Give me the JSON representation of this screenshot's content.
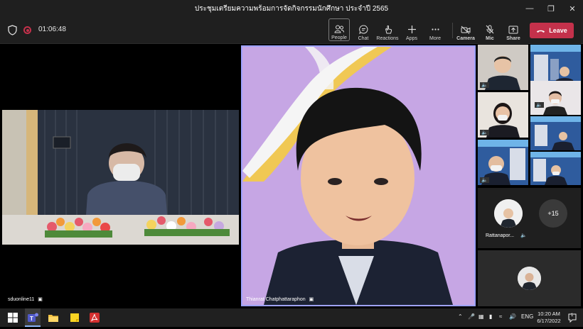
{
  "window": {
    "title": "ประชุมเตรียมความพร้อมการจัดกิจกรรมนักศึกษา ประจำปี 2565"
  },
  "toolbar": {
    "timer": "01:06:48",
    "people_label": "People",
    "chat_label": "Chat",
    "reactions_label": "Reactions",
    "apps_label": "Apps",
    "more_label": "More",
    "camera_label": "Camera",
    "mic_label": "Mic",
    "share_label": "Share",
    "leave_label": "Leave"
  },
  "participants": {
    "main_left_name": "sduonline11",
    "main_center_name": "Thianrat Chatphattaraphon",
    "side_participant_name": "Rattanapor...",
    "overflow_count": "+15"
  },
  "taskbar": {
    "language": "ENG",
    "time": "10:20 AM",
    "date": "6/17/2022",
    "notification_count": "1"
  },
  "colors": {
    "leave_red": "#c4314b",
    "bg_dark": "#1f1f1f",
    "purple_bg": "#c9a9e6",
    "highlight_border": "#9ea2ff"
  }
}
